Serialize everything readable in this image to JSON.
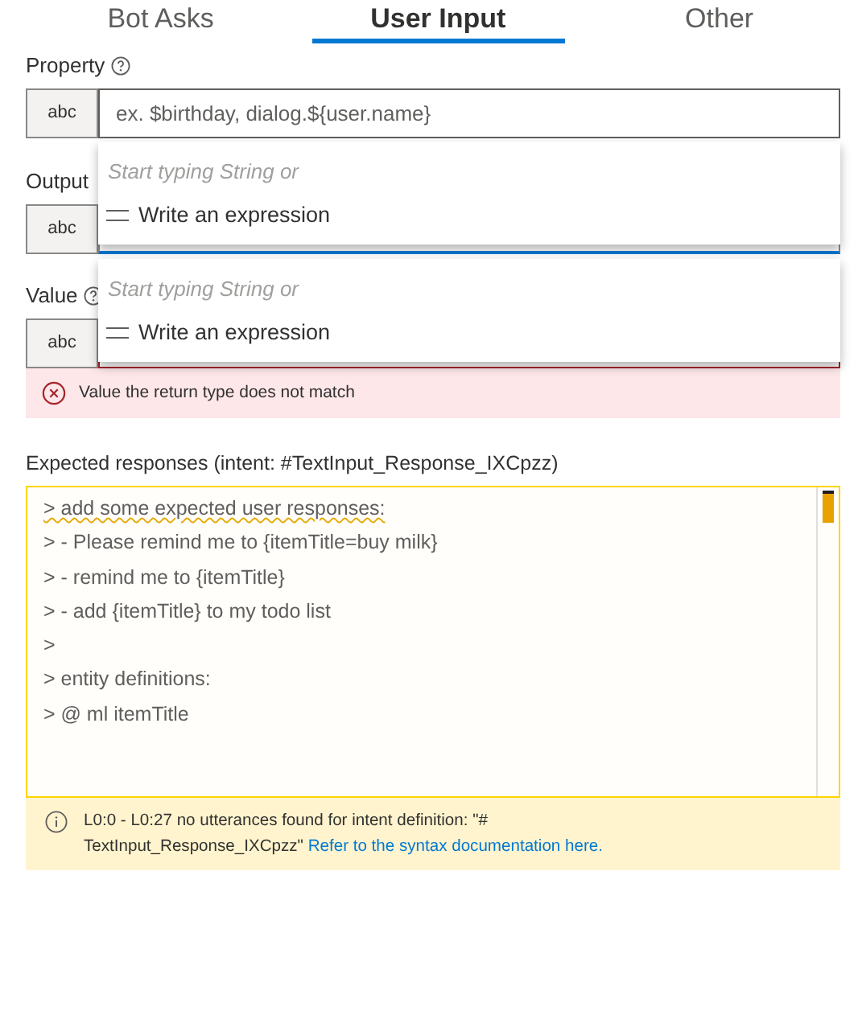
{
  "tabs": [
    {
      "label": "Bot Asks",
      "selected": false
    },
    {
      "label": "User Input",
      "selected": true
    },
    {
      "label": "Other",
      "selected": false
    }
  ],
  "fields": [
    {
      "label": "Property",
      "help": true,
      "type_button": "abc",
      "placeholder": "ex. $birthday, dialog.${user.name}",
      "focused": false,
      "invalid": false
    },
    {
      "label": "Output",
      "help": false,
      "type_button": "abc",
      "focused": true,
      "invalid": false
    },
    {
      "label": "Value",
      "help": true,
      "type_button": "abc",
      "focused": false,
      "invalid": true,
      "error": "Value the return type does not match"
    }
  ],
  "dropdowns": [
    {
      "hint": "Start typing String or",
      "option": "Write an expression"
    },
    {
      "hint": "Start typing String or",
      "option": "Write an expression"
    }
  ],
  "expected_responses": {
    "label": "Expected responses (intent: #TextInput_Response_IXCpzz)",
    "lines": [
      {
        "text": "> add some expected user responses:",
        "squiggle": true
      },
      {
        "text": "> - Please remind me to {itemTitle=buy milk}",
        "squiggle": false
      },
      {
        "text": "> - remind me to {itemTitle}",
        "squiggle": false
      },
      {
        "text": "> - add {itemTitle} to my todo list",
        "squiggle": false
      },
      {
        "text": ">",
        "squiggle": false
      },
      {
        "text": "> entity definitions:",
        "squiggle": false
      },
      {
        "text": "> @ ml itemTitle",
        "squiggle": false
      }
    ],
    "warning": {
      "text": "L0:0 - L0:27 no utterances found for intent definition: \"# TextInput_Response_IXCpzz\"",
      "link": "Refer to the syntax documentation here."
    }
  }
}
